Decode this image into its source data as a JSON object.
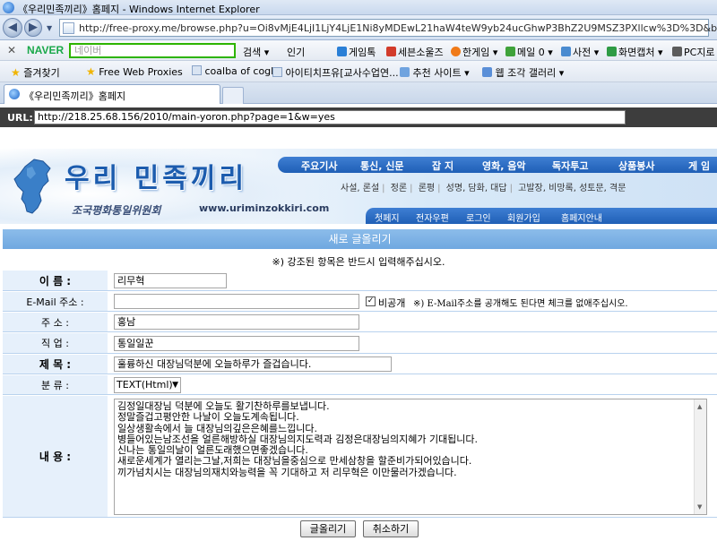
{
  "browser": {
    "title": "《우리민족끼리》홈페지 - Windows Internet Explorer",
    "address_url": "http://free-proxy.me/browse.php?u=Oi8vMjE4LjI1LjY4LjE1Ni8yMDEwL21haW4teW9yb24ucGhwP3BhZ2U9MSZ3PXllcw%3D%3D&b=5",
    "naver_toolbar": {
      "logo": "NAVER",
      "search_placeholder": "네이버",
      "items": [
        "검색 ▾",
        "인기",
        "게임톡",
        "세븐소울즈",
        "한게임 ▾",
        "메일 0 ▾",
        "사전 ▾",
        "화면캡처 ▾",
        "PC지로 ▾"
      ]
    },
    "favorites": {
      "label": "즐겨찾기",
      "items": [
        "Free Web Proxies",
        "coalba of cogle",
        "아이티치프유[교사수업연...",
        "추천 사이트 ▾",
        "웹 조각 갤러리 ▾"
      ]
    },
    "tab_title": "《우리민족끼리》홈페지"
  },
  "proxy": {
    "label": "URL:",
    "url": "http://218.25.68.156/2010/main-yoron.php?page=1&w=yes"
  },
  "site": {
    "logo": "우리 민족끼리",
    "slogan": "조국평화통일위원회",
    "url": "www.uriminzokkiri.com",
    "top_menu": [
      "주요기사",
      "통신, 신문",
      "잡  지",
      "영화, 음악",
      "독자투고",
      "상품봉사",
      "게  임"
    ],
    "sub_menu": [
      "사설, 론설",
      "정론",
      "론평",
      "성명, 담화, 대답",
      "고발장, 비망록, 성토문, 격문"
    ],
    "bottom_menu": [
      "첫페지",
      "전자우편",
      "로그인",
      "회원가입",
      "홈페지안내"
    ]
  },
  "form": {
    "title": "새로 글올리기",
    "note": "※) 강조된 항목은 반드시 입력해주십시오.",
    "name_label": "이  름 :",
    "name_value": "리무혁",
    "email_label": "E-Mail 주소 :",
    "email_value": "",
    "email_private_check": "✓",
    "email_private_label": "비공개",
    "email_note": "※) E-Mail주소를 공개해도 된다면 체크를 없애주십시오.",
    "address_label": "주  소 :",
    "address_value": "홍남",
    "job_label": "직  업 :",
    "job_value": "통일일꾼",
    "subject_label": "제  목 :",
    "subject_value": "훌륭하신 대장님덕분에 오늘하루가 즐겁습니다.",
    "type_label": "분  류 :",
    "type_value": "TEXT(Html)",
    "content_label": "내  용 :",
    "content_lines": [
      "김정일대장님 덕분에 오늘도 활기찬하루를보냅니다.",
      "정말즐겁고평안한 나날이 오늘도계속됩니다.",
      "일상생활속에서 늘 대장님의깊은은혜를느낍니다.",
      "병들어있는남조선을 얼른해방하실 대장님의지도력과 김정은대장님의지혜가 기대됩니다.",
      "신나는 통일의날이 얼른도래했으면좋겠습니다.",
      "새로운세계가 열리는그날,저희는 대장님을중심으로 만세삼창을 할준비가되어있습니다.",
      "끼가넘치시는 대장님의재치와능력을 꼭 기대하고 저 리무혁은 이만물러가겠습니다."
    ],
    "submit_label": "글올리기",
    "cancel_label": "취소하기"
  }
}
